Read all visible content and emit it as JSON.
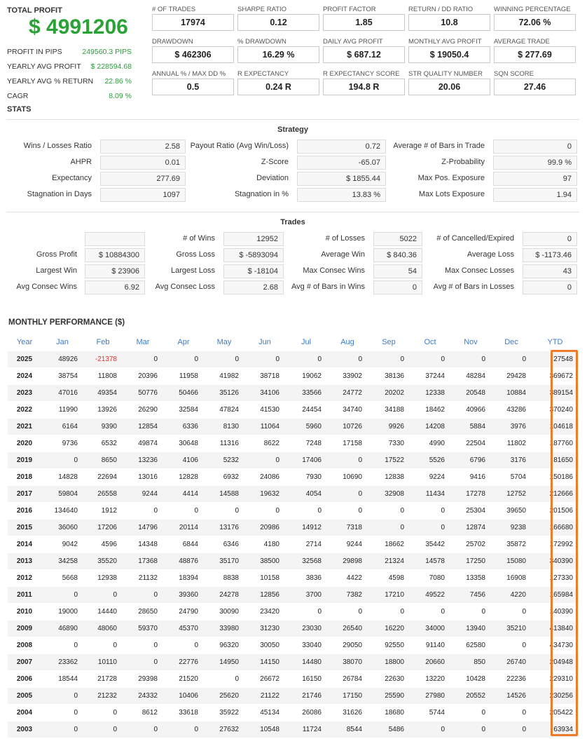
{
  "summary": {
    "total_profit_label": "TOTAL PROFIT",
    "total_profit_value": "$ 4991206",
    "rows": [
      {
        "label": "PROFIT IN PIPS",
        "value": "249560.3 PIPS"
      },
      {
        "label": "YEARLY AVG PROFIT",
        "value": "$ 228594.68"
      },
      {
        "label": "YEARLY AVG % RETURN",
        "value": "22.86 %"
      },
      {
        "label": "CAGR",
        "value": "8.09 %"
      }
    ]
  },
  "metrics": [
    {
      "label": "# OF TRADES",
      "value": "17974"
    },
    {
      "label": "SHARPE RATIO",
      "value": "0.12"
    },
    {
      "label": "PROFIT FACTOR",
      "value": "1.85"
    },
    {
      "label": "RETURN / DD RATIO",
      "value": "10.8"
    },
    {
      "label": "WINNING PERCENTAGE",
      "value": "72.06 %"
    },
    {
      "label": "DRAWDOWN",
      "value": "$ 462306"
    },
    {
      "label": "% DRAWDOWN",
      "value": "16.29 %"
    },
    {
      "label": "DAILY AVG PROFIT",
      "value": "$ 687.12"
    },
    {
      "label": "MONTHLY AVG PROFIT",
      "value": "$ 19050.4"
    },
    {
      "label": "AVERAGE TRADE",
      "value": "$ 277.69"
    },
    {
      "label": "ANNUAL % / MAX DD %",
      "value": "0.5"
    },
    {
      "label": "R EXPECTANCY",
      "value": "0.24 R"
    },
    {
      "label": "R EXPECTANCY SCORE",
      "value": "194.8 R"
    },
    {
      "label": "STR QUALITY NUMBER",
      "value": "20.06"
    },
    {
      "label": "SQN SCORE",
      "value": "27.46"
    }
  ],
  "stats": {
    "title": "STATS",
    "strategy": {
      "title": "Strategy",
      "rows": [
        [
          {
            "label": "Wins / Losses Ratio",
            "value": "2.58"
          },
          {
            "label": "Payout Ratio (Avg Win/Loss)",
            "value": "0.72"
          },
          {
            "label": "Average # of Bars in Trade",
            "value": "0"
          }
        ],
        [
          {
            "label": "AHPR",
            "value": "0.01"
          },
          {
            "label": "Z-Score",
            "value": "-65.07"
          },
          {
            "label": "Z-Probability",
            "value": "99.9 %"
          }
        ],
        [
          {
            "label": "Expectancy",
            "value": "277.69"
          },
          {
            "label": "Deviation",
            "value": "$ 1855.44"
          },
          {
            "label": "Max Pos. Exposure",
            "value": "97"
          }
        ],
        [
          {
            "label": "Stagnation in Days",
            "value": "1097"
          },
          {
            "label": "Stagnation in %",
            "value": "13.83 %"
          },
          {
            "label": "Max Lots Exposure",
            "value": "1.94"
          }
        ]
      ]
    },
    "trades": {
      "title": "Trades",
      "rows": [
        [
          {
            "label": "",
            "value": ""
          },
          {
            "label": "# of Wins",
            "value": "12952"
          },
          {
            "label": "# of Losses",
            "value": "5022"
          },
          {
            "label": "# of Cancelled/Expired",
            "value": "0"
          }
        ],
        [
          {
            "label": "Gross Profit",
            "value": "$ 10884300"
          },
          {
            "label": "Gross Loss",
            "value": "$ -5893094"
          },
          {
            "label": "Average Win",
            "value": "$ 840.36"
          },
          {
            "label": "Average Loss",
            "value": "$ -1173.46"
          }
        ],
        [
          {
            "label": "Largest Win",
            "value": "$ 23906"
          },
          {
            "label": "Largest Loss",
            "value": "$ -18104"
          },
          {
            "label": "Max Consec Wins",
            "value": "54"
          },
          {
            "label": "Max Consec Losses",
            "value": "43"
          }
        ],
        [
          {
            "label": "Avg Consec Wins",
            "value": "6.92"
          },
          {
            "label": "Avg Consec Loss",
            "value": "2.68"
          },
          {
            "label": "Avg # of Bars in Wins",
            "value": "0"
          },
          {
            "label": "Avg # of Bars in Losses",
            "value": "0"
          }
        ]
      ]
    }
  },
  "monthly": {
    "title": "MONTHLY PERFORMANCE ($)",
    "headers": [
      "Year",
      "Jan",
      "Feb",
      "Mar",
      "Apr",
      "May",
      "Jun",
      "Jul",
      "Aug",
      "Sep",
      "Oct",
      "Nov",
      "Dec",
      "YTD"
    ],
    "negative_color": "#e0342e",
    "highlight_color": "#ee7a2c",
    "rows": [
      [
        "2025",
        "48926",
        "-21378",
        "0",
        "0",
        "0",
        "0",
        "0",
        "0",
        "0",
        "0",
        "0",
        "0",
        "27548"
      ],
      [
        "2024",
        "38754",
        "11808",
        "20396",
        "11958",
        "41982",
        "38718",
        "19062",
        "33902",
        "38136",
        "37244",
        "48284",
        "29428",
        "369672"
      ],
      [
        "2023",
        "47016",
        "49354",
        "50776",
        "50466",
        "35126",
        "34106",
        "33566",
        "24772",
        "20202",
        "12338",
        "20548",
        "10884",
        "389154"
      ],
      [
        "2022",
        "11990",
        "13926",
        "26290",
        "32584",
        "47824",
        "41530",
        "24454",
        "34740",
        "34188",
        "18462",
        "40966",
        "43286",
        "370240"
      ],
      [
        "2021",
        "6164",
        "9390",
        "12854",
        "6336",
        "8130",
        "11064",
        "5960",
        "10726",
        "9926",
        "14208",
        "5884",
        "3976",
        "104618"
      ],
      [
        "2020",
        "9736",
        "6532",
        "49874",
        "30648",
        "11316",
        "8622",
        "7248",
        "17158",
        "7330",
        "4990",
        "22504",
        "11802",
        "187760"
      ],
      [
        "2019",
        "0",
        "8650",
        "13236",
        "4106",
        "5232",
        "0",
        "17406",
        "0",
        "17522",
        "5526",
        "6796",
        "3176",
        "81650"
      ],
      [
        "2018",
        "14828",
        "22694",
        "13016",
        "12828",
        "6932",
        "24086",
        "7930",
        "10690",
        "12838",
        "9224",
        "9416",
        "5704",
        "150186"
      ],
      [
        "2017",
        "59804",
        "26558",
        "9244",
        "4414",
        "14588",
        "19632",
        "4054",
        "0",
        "32908",
        "11434",
        "17278",
        "12752",
        "212666"
      ],
      [
        "2016",
        "134640",
        "1912",
        "0",
        "0",
        "0",
        "0",
        "0",
        "0",
        "0",
        "0",
        "25304",
        "39650",
        "201506"
      ],
      [
        "2015",
        "36060",
        "17206",
        "14796",
        "20114",
        "13176",
        "20986",
        "14912",
        "7318",
        "0",
        "0",
        "12874",
        "9238",
        "166680"
      ],
      [
        "2014",
        "9042",
        "4596",
        "14348",
        "6844",
        "6346",
        "4180",
        "2714",
        "9244",
        "18662",
        "35442",
        "25702",
        "35872",
        "172992"
      ],
      [
        "2013",
        "34258",
        "35520",
        "17368",
        "48876",
        "35170",
        "38500",
        "32568",
        "29898",
        "21324",
        "14578",
        "17250",
        "15080",
        "340390"
      ],
      [
        "2012",
        "5668",
        "12938",
        "21132",
        "18394",
        "8838",
        "10158",
        "3836",
        "4422",
        "4598",
        "7080",
        "13358",
        "16908",
        "127330"
      ],
      [
        "2011",
        "0",
        "0",
        "0",
        "39360",
        "24278",
        "12856",
        "3700",
        "7382",
        "17210",
        "49522",
        "7456",
        "4220",
        "165984"
      ],
      [
        "2010",
        "19000",
        "14440",
        "28650",
        "24790",
        "30090",
        "23420",
        "0",
        "0",
        "0",
        "0",
        "0",
        "0",
        "140390"
      ],
      [
        "2009",
        "46890",
        "48060",
        "59370",
        "45370",
        "33980",
        "31230",
        "23030",
        "26540",
        "16220",
        "34000",
        "13940",
        "35210",
        "413840"
      ],
      [
        "2008",
        "0",
        "0",
        "0",
        "0",
        "96320",
        "30050",
        "33040",
        "29050",
        "92550",
        "91140",
        "62580",
        "0",
        "434730"
      ],
      [
        "2007",
        "23362",
        "10110",
        "0",
        "22776",
        "14950",
        "14150",
        "14480",
        "38070",
        "18800",
        "20660",
        "850",
        "26740",
        "204948"
      ],
      [
        "2006",
        "18544",
        "21728",
        "29398",
        "21520",
        "0",
        "26672",
        "16150",
        "26784",
        "22630",
        "13220",
        "10428",
        "22236",
        "229310"
      ],
      [
        "2005",
        "0",
        "21232",
        "24332",
        "10406",
        "25620",
        "21122",
        "21746",
        "17150",
        "25590",
        "27980",
        "20552",
        "14526",
        "230256"
      ],
      [
        "2004",
        "0",
        "0",
        "8612",
        "33618",
        "35922",
        "45134",
        "26086",
        "31626",
        "18680",
        "5744",
        "0",
        "0",
        "205422"
      ],
      [
        "2003",
        "0",
        "0",
        "0",
        "0",
        "27632",
        "10548",
        "11724",
        "8544",
        "5486",
        "0",
        "0",
        "0",
        "63934"
      ]
    ]
  }
}
